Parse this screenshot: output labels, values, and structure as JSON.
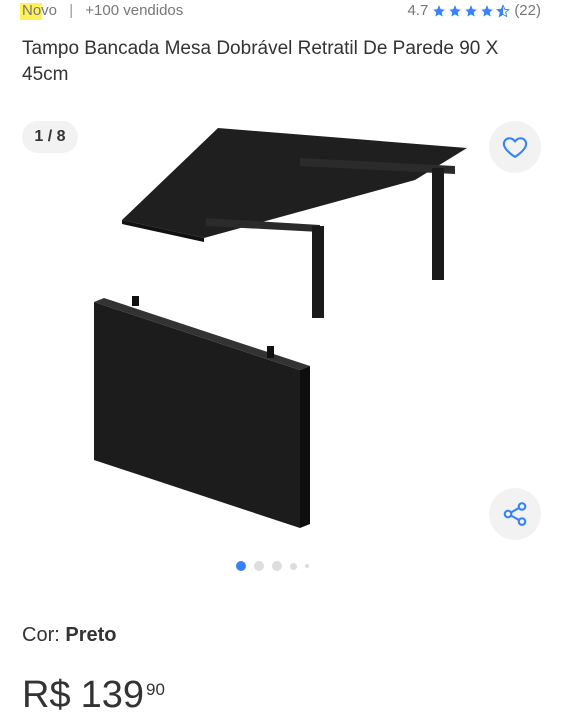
{
  "header": {
    "condition": "Novo",
    "separator": "|",
    "sold": "+100 vendidos",
    "rating_value": "4.7",
    "stars": 4.7,
    "review_count": "(22)"
  },
  "product": {
    "title": "Tampo Bancada Mesa Dobrável Retratil De Parede 90 X 45cm"
  },
  "gallery": {
    "counter": "1 / 8",
    "total_images": 8,
    "active_index": 0
  },
  "icons": {
    "favorite": "heart-icon",
    "share": "share-icon"
  },
  "variation": {
    "label": "Cor:",
    "value": "Preto"
  },
  "price": {
    "currency": "R$",
    "integer": "139",
    "cents": "90"
  },
  "colors": {
    "accent": "#3483fa",
    "highlight": "#fff159",
    "star": "#3483fa"
  }
}
